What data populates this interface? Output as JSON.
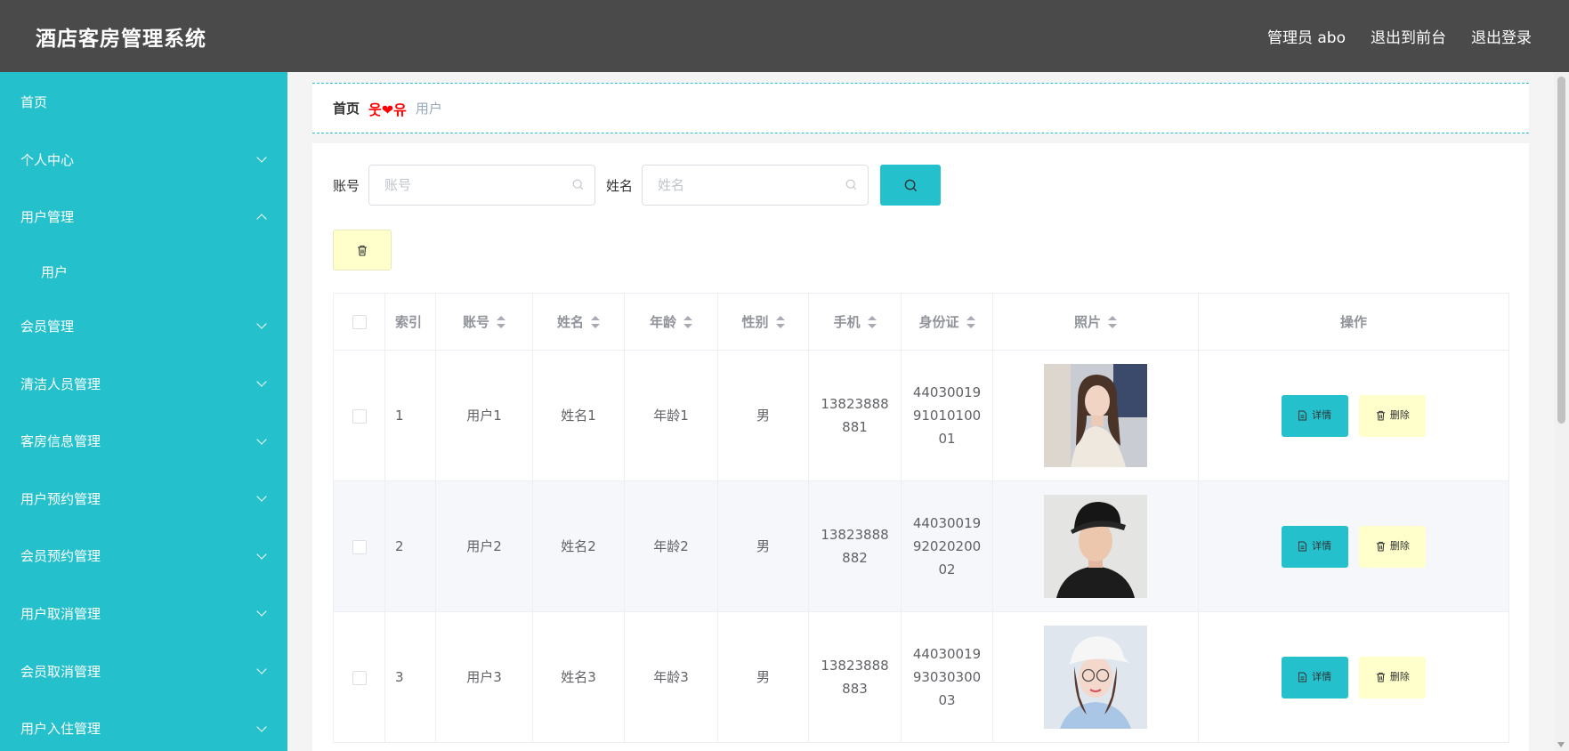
{
  "header": {
    "app_title": "酒店客房管理系统",
    "admin_label": "管理员 abo",
    "front_label": "退出到前台",
    "logout_label": "退出登录"
  },
  "sidebar": {
    "items": [
      {
        "label": "首页"
      },
      {
        "label": "个人中心"
      },
      {
        "label": "用户管理"
      },
      {
        "label": "用户"
      },
      {
        "label": "会员管理"
      },
      {
        "label": "清洁人员管理"
      },
      {
        "label": "客房信息管理"
      },
      {
        "label": "用户预约管理"
      },
      {
        "label": "会员预约管理"
      },
      {
        "label": "用户取消管理"
      },
      {
        "label": "会员取消管理"
      },
      {
        "label": "用户入住管理"
      }
    ]
  },
  "breadcrumb": {
    "home": "首页",
    "separator": "웃❤유",
    "current": "用户"
  },
  "search": {
    "account_label": "账号",
    "account_placeholder": "账号",
    "name_label": "姓名",
    "name_placeholder": "姓名"
  },
  "table": {
    "headers": [
      "索引",
      "账号",
      "姓名",
      "年龄",
      "性别",
      "手机",
      "身份证",
      "照片",
      "操作"
    ],
    "rows": [
      {
        "index": "1",
        "account": "用户1",
        "name": "姓名1",
        "age": "年龄1",
        "gender": "男",
        "phone_a": "13823888",
        "phone_b": "881",
        "id_a": "44030019",
        "id_b": "91010100",
        "id_c": "01"
      },
      {
        "index": "2",
        "account": "用户2",
        "name": "姓名2",
        "age": "年龄2",
        "gender": "男",
        "phone_a": "13823888",
        "phone_b": "882",
        "id_a": "44030019",
        "id_b": "92020200",
        "id_c": "02"
      },
      {
        "index": "3",
        "account": "用户3",
        "name": "姓名3",
        "age": "年龄3",
        "gender": "男",
        "phone_a": "13823888",
        "phone_b": "883",
        "id_a": "44030019",
        "id_b": "93030300",
        "id_c": "03"
      }
    ],
    "detail_label": "详情",
    "delete_label": "删除"
  },
  "colors": {
    "accent": "#24c1cd",
    "topbar": "#4a4a4a",
    "delete_bg": "#ffffcc"
  }
}
